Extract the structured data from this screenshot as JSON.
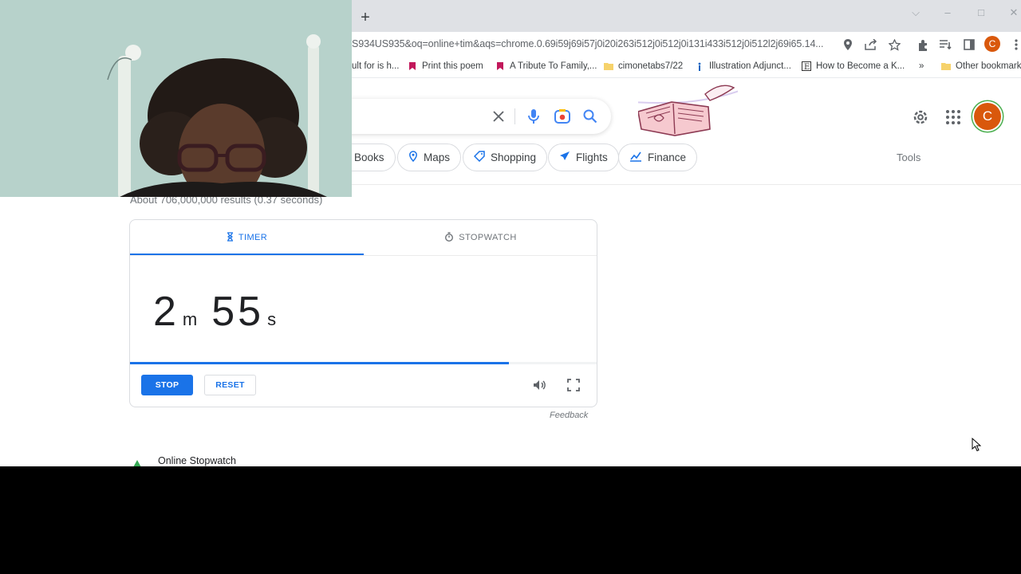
{
  "browser": {
    "url": "S934US935&oq=online+tim&aqs=chrome.0.69i59j69i57j0i20i263i512j0i512j0i131i433i512j0i512l2j69i65.14...",
    "profile_initial": "C",
    "bookmarks": [
      {
        "label": "ult for is h...",
        "icon": "page-icon"
      },
      {
        "label": "Print this poem",
        "icon": "ribbon-icon"
      },
      {
        "label": "A Tribute To Family,...",
        "icon": "ribbon-icon"
      },
      {
        "label": "cimonetabs7/22",
        "icon": "folder-icon"
      },
      {
        "label": "Illustration Adjunct...",
        "icon": "info-icon"
      },
      {
        "label": "How to Become a K...",
        "icon": "e-icon"
      },
      {
        "label": "»",
        "icon": ""
      },
      {
        "label": "Other bookmarks",
        "icon": "folder-icon"
      }
    ]
  },
  "search": {
    "chips": [
      {
        "label": "Books",
        "icon": ""
      },
      {
        "label": "Maps",
        "icon": "map-pin-icon"
      },
      {
        "label": "Shopping",
        "icon": "tag-icon"
      },
      {
        "label": "Flights",
        "icon": "plane-icon"
      },
      {
        "label": "Finance",
        "icon": "finance-icon"
      }
    ],
    "tools_label": "Tools",
    "result_stats": "About 706,000,000 results (0.37 seconds)",
    "avatar_initial": "C"
  },
  "timer": {
    "tab_timer": "TIMER",
    "tab_stopwatch": "STOPWATCH",
    "minutes": "2",
    "minutes_unit": "m",
    "seconds": "55",
    "seconds_unit": "s",
    "progress_fraction": 0.81,
    "stop_label": "STOP",
    "reset_label": "RESET",
    "feedback_label": "Feedback"
  },
  "results": {
    "first_title": "Online Stopwatch"
  },
  "colors": {
    "accent": "#1a73e8",
    "avatar": "#d9580c"
  }
}
